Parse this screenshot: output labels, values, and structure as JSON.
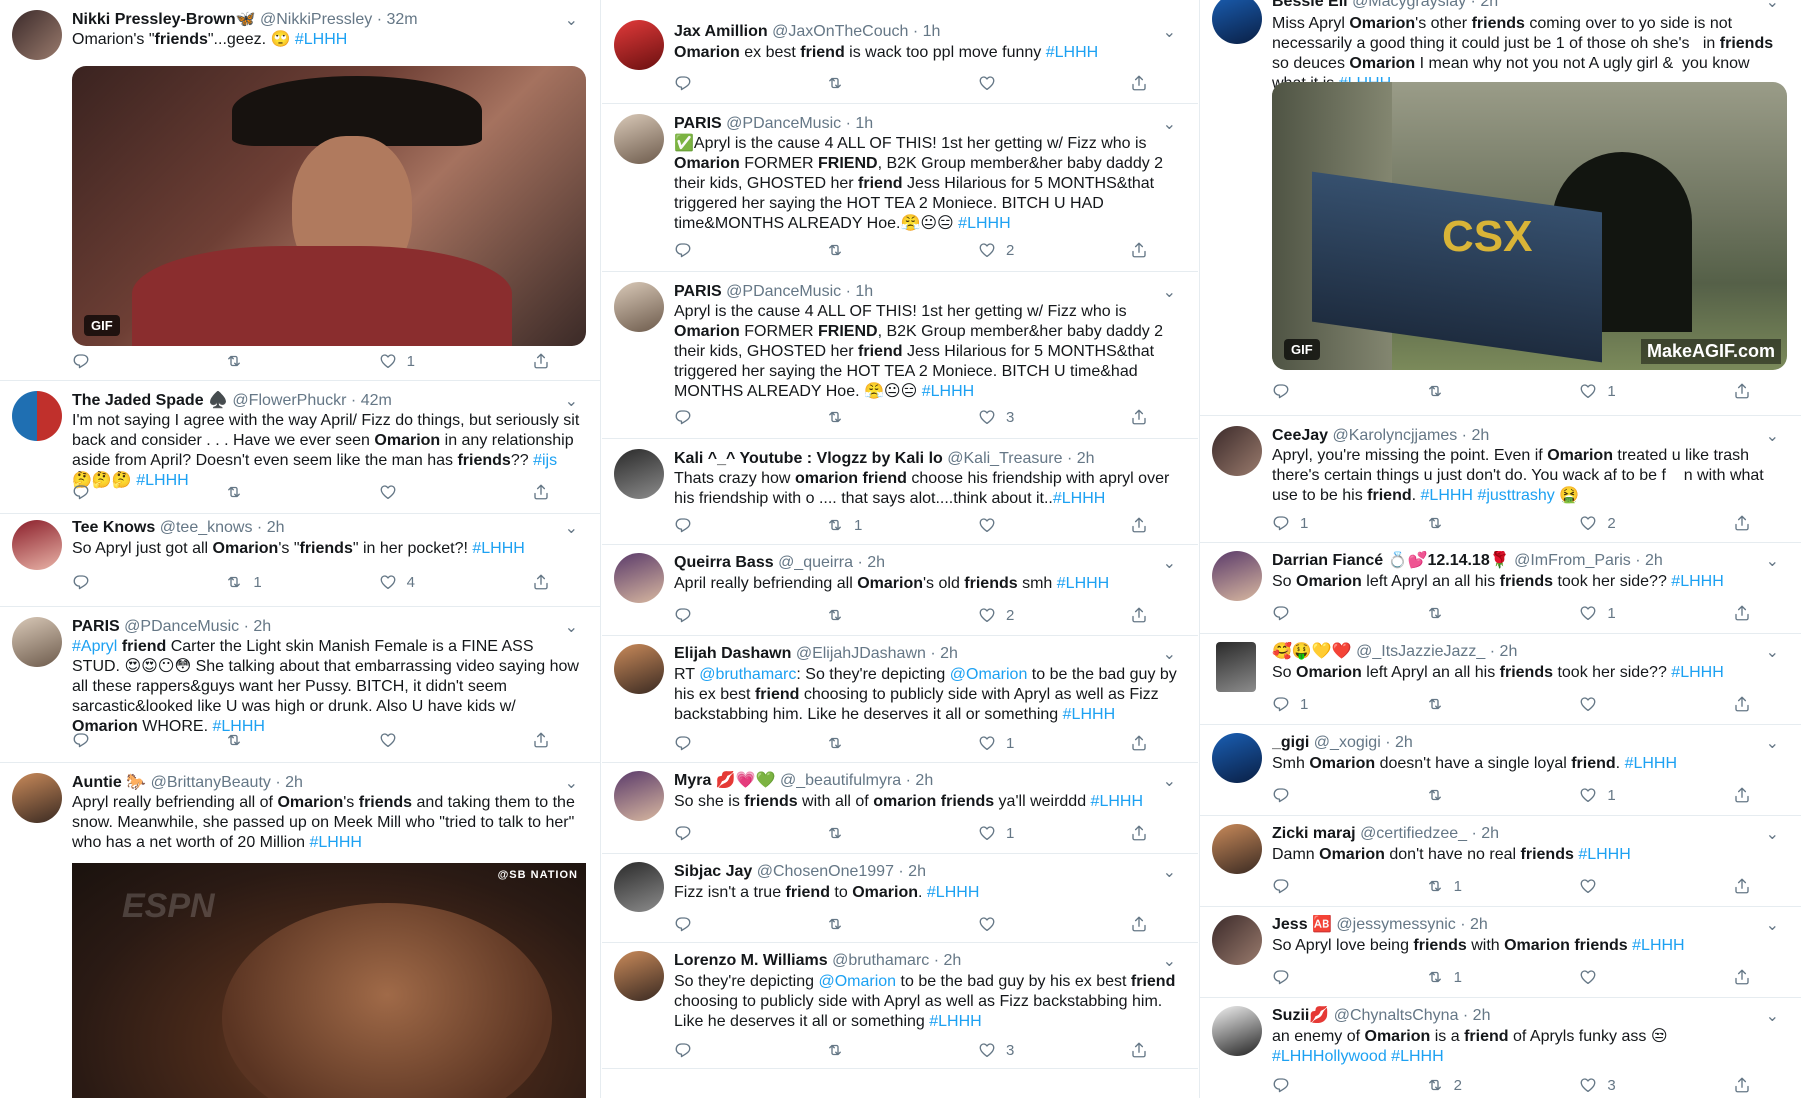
{
  "colors": {
    "accent": "#1da1f2",
    "text": "#14171a",
    "meta": "#657786",
    "border": "#e6ecf0"
  },
  "icons": {
    "reply": "reply-icon",
    "retweet": "retweet-icon",
    "like": "like-icon",
    "share": "share-icon",
    "caret": "chevron-down-icon"
  },
  "caret_glyph": "⌄",
  "col1": [
    {
      "name": "Nikki Pressley-Brown🦋",
      "meta": "@NikkiPressley · 32m",
      "reply": "",
      "retweet": "",
      "like": "1",
      "media_badge": "GIF"
    },
    {
      "name": "The Jaded Spade ♠️",
      "meta": "@FlowerPhuckr · 42m",
      "reply": "",
      "retweet": "",
      "like": ""
    },
    {
      "name": "Tee Knows",
      "meta": "@tee_knows · 2h",
      "reply": "",
      "retweet": "1",
      "like": "4"
    },
    {
      "name": "PARIS",
      "meta": "@PDanceMusic · 2h",
      "reply": "",
      "retweet": "",
      "like": ""
    },
    {
      "name": "Auntie 🐎",
      "meta": "@BrittanyBeauty · 2h",
      "media_wm": "@SB NATION",
      "media_wm2": "ESPN"
    }
  ],
  "col2": [
    {
      "name": "Jax Amillion",
      "meta": "@JaxOnTheCouch · 1h",
      "reply": "",
      "retweet": "",
      "like": ""
    },
    {
      "name": "PARIS",
      "meta": "@PDanceMusic · 1h",
      "reply": "",
      "retweet": "",
      "like": "2"
    },
    {
      "name": "PARIS",
      "meta": "@PDanceMusic · 1h",
      "reply": "",
      "retweet": "",
      "like": "3"
    },
    {
      "name": "Kali ^_^ Youtube : Vlogzz by Kali lo",
      "meta": "@Kali_Treasure · 2h",
      "reply": "",
      "retweet": "1",
      "like": ""
    },
    {
      "name": "Queirra Bass",
      "meta": "@_queirra · 2h",
      "reply": "",
      "retweet": "",
      "like": "2"
    },
    {
      "name": "Elijah Dashawn",
      "meta": "@ElijahJDashawn · 2h",
      "reply": "",
      "retweet": "",
      "like": "1"
    },
    {
      "name": "Myra 💋💗💚",
      "meta": "@_beautifulmyra · 2h",
      "reply": "",
      "retweet": "",
      "like": "1"
    },
    {
      "name": "Sibjac Jay",
      "meta": "@ChosenOne1997 · 2h",
      "reply": "",
      "retweet": "",
      "like": ""
    },
    {
      "name": "Lorenzo M. Williams",
      "meta": "@bruthamarc · 2h",
      "reply": "",
      "retweet": "",
      "like": "3"
    }
  ],
  "col3": [
    {
      "name": "Bessie Ell",
      "meta": "@Macygrayslay · 2h",
      "reply": "",
      "retweet": "",
      "like": "1",
      "media_badge": "GIF",
      "media_wm": "MakeAGIF.com"
    },
    {
      "name": "CeeJay",
      "meta": "@Karolyncjjames · 2h",
      "reply": "1",
      "retweet": "",
      "like": "2"
    },
    {
      "name": "Darrian Fiancé 💍💕12.14.18🌹",
      "meta": "@ImFrom_Paris · 2h",
      "reply": "",
      "retweet": "",
      "like": "1"
    },
    {
      "name": "🥰🤑💛❤️",
      "meta": "@_ItsJazzieJazz_ · 2h",
      "reply": "1",
      "retweet": "",
      "like": ""
    },
    {
      "name": "_gigi",
      "meta": "@_xogigi · 2h",
      "reply": "",
      "retweet": "",
      "like": "1"
    },
    {
      "name": "Zicki maraj",
      "meta": "@certifiedzee_ · 2h",
      "reply": "",
      "retweet": "1",
      "like": ""
    },
    {
      "name": "Jess 🆎",
      "meta": "@jessymessynic · 2h",
      "reply": "",
      "retweet": "1",
      "like": ""
    },
    {
      "name": "Suzii💋",
      "meta": "@ChynaltsChyna · 2h",
      "reply": "",
      "retweet": "2",
      "like": "3"
    }
  ]
}
